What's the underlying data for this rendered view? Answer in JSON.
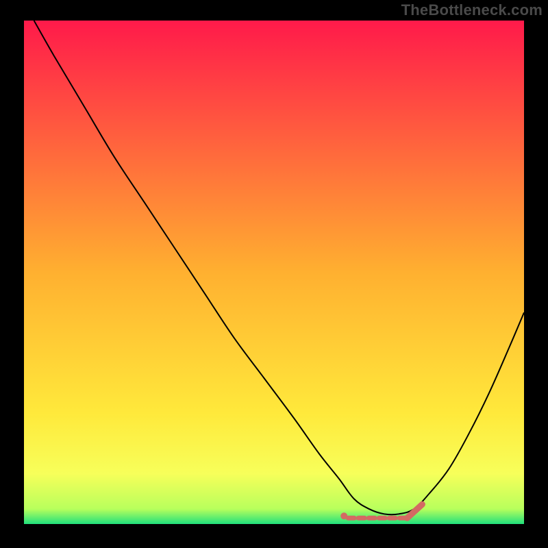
{
  "attribution": "TheBottleneck.com",
  "colors": {
    "gradient_top": "#ff1a4a",
    "gradient_mid": "#ffe93b",
    "gradient_bottom_yellow": "#f7ff5a",
    "gradient_bottom_green": "#20e07c",
    "curve": "#000000",
    "highlight_marker": "#d36a63",
    "frame": "#000000"
  },
  "chart_data": {
    "type": "line",
    "title": "",
    "xlabel": "",
    "ylabel": "",
    "x_range": [
      0,
      100
    ],
    "y_range": [
      0,
      100
    ],
    "series": [
      {
        "name": "bottleneck-curve",
        "x": [
          2,
          6,
          12,
          18,
          24,
          30,
          36,
          42,
          48,
          54,
          59,
          63,
          66,
          69,
          72,
          75,
          78,
          81,
          85,
          89,
          93,
          97,
          100
        ],
        "y": [
          100,
          93,
          83,
          73,
          64,
          55,
          46,
          37,
          29,
          21,
          14,
          9,
          5,
          3,
          2,
          2,
          3,
          6,
          11,
          18,
          26,
          35,
          42
        ]
      }
    ],
    "highlight_region": {
      "name": "optimal-range",
      "x_start": 64,
      "x_end": 78,
      "y": 2
    },
    "gradient_stops": [
      {
        "offset": 0,
        "color": "#ff1a4a"
      },
      {
        "offset": 50,
        "color": "#ffb030"
      },
      {
        "offset": 78,
        "color": "#ffe93b"
      },
      {
        "offset": 90,
        "color": "#f7ff5a"
      },
      {
        "offset": 97,
        "color": "#b8ff5c"
      },
      {
        "offset": 100,
        "color": "#20e07c"
      }
    ]
  }
}
